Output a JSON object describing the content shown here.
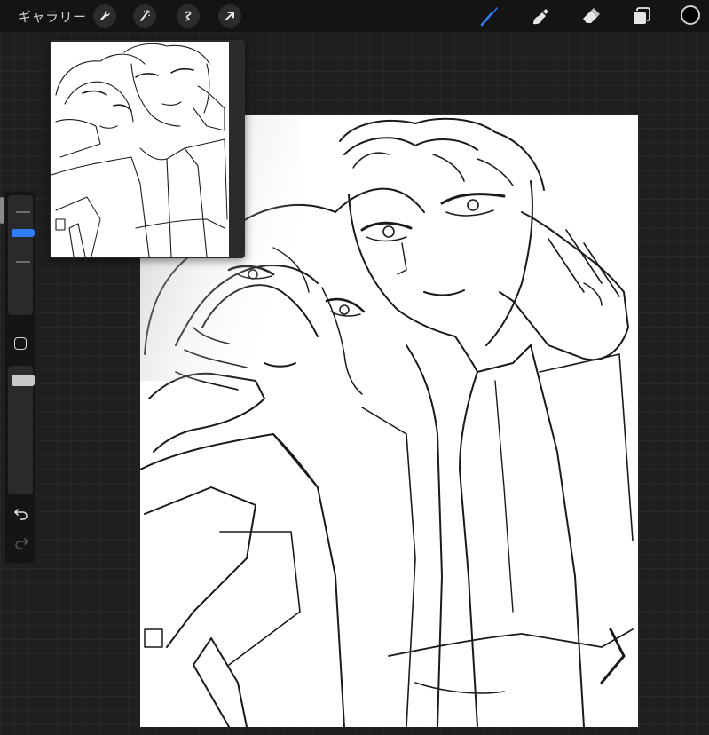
{
  "toolbar": {
    "gallery_label": "ギャラリー",
    "left_tools": [
      "wrench-icon",
      "magic-wand-icon",
      "selection-icon",
      "transform-arrow-icon"
    ],
    "right_tools": [
      "brush-icon",
      "smudge-icon",
      "eraser-icon",
      "layers-icon"
    ],
    "active_tool": "brush",
    "accent_color": "#2f7cf6",
    "current_color": "#000000"
  },
  "sidebar": {
    "brush_size": 0.42,
    "opacity": 1.0,
    "modify_button_icon": "square-icon",
    "undo_icon": "undo-arrow-icon",
    "redo_icon": "redo-arrow-icon"
  },
  "canvas": {
    "background": "#ffffff",
    "content": "line-art-sketch"
  },
  "reference": {
    "content": "line-art-thumbnail"
  }
}
